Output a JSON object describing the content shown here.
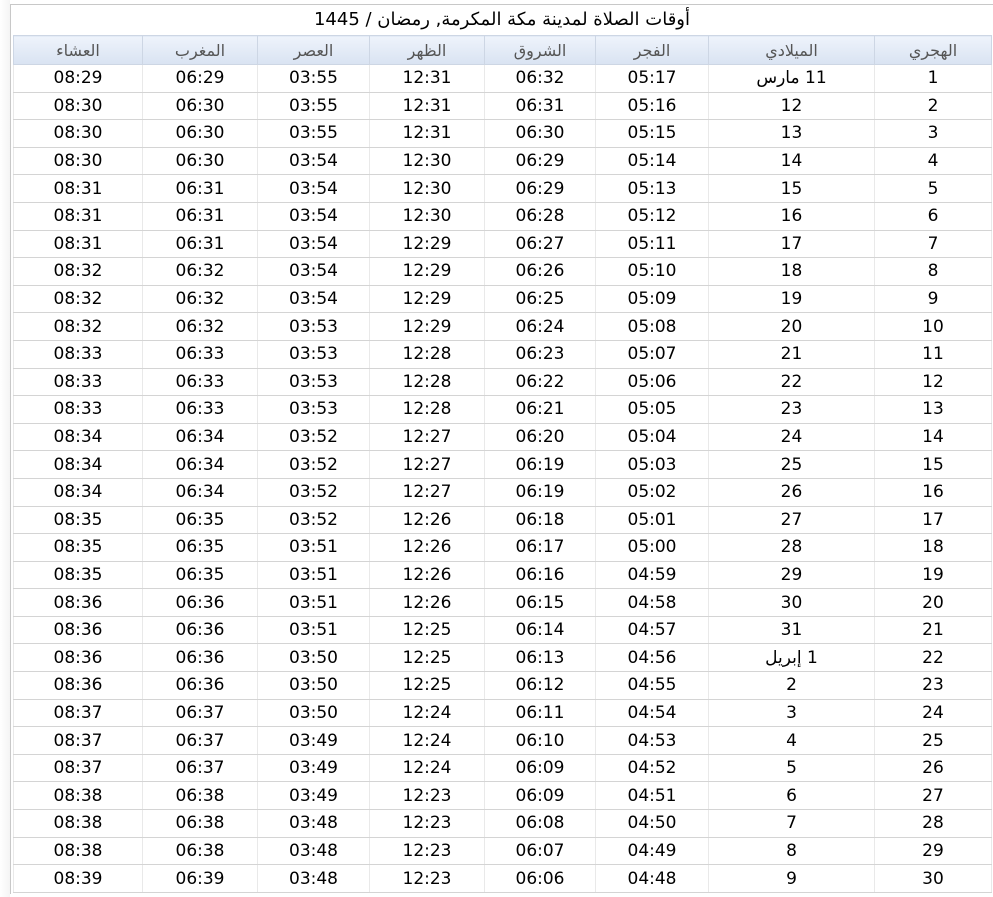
{
  "title": "أوقات الصلاة لمدينة مكة المكرمة, رمضان / 1445",
  "headers": [
    "الهجري",
    "الميلادي",
    "الفجر",
    "الشروق",
    "الظهر",
    "العصر",
    "المغرب",
    "العشاء"
  ],
  "rows": [
    [
      "1",
      "11 مارس",
      "05:17",
      "06:32",
      "12:31",
      "03:55",
      "06:29",
      "08:29"
    ],
    [
      "2",
      "12",
      "05:16",
      "06:31",
      "12:31",
      "03:55",
      "06:30",
      "08:30"
    ],
    [
      "3",
      "13",
      "05:15",
      "06:30",
      "12:31",
      "03:55",
      "06:30",
      "08:30"
    ],
    [
      "4",
      "14",
      "05:14",
      "06:29",
      "12:30",
      "03:54",
      "06:30",
      "08:30"
    ],
    [
      "5",
      "15",
      "05:13",
      "06:29",
      "12:30",
      "03:54",
      "06:31",
      "08:31"
    ],
    [
      "6",
      "16",
      "05:12",
      "06:28",
      "12:30",
      "03:54",
      "06:31",
      "08:31"
    ],
    [
      "7",
      "17",
      "05:11",
      "06:27",
      "12:29",
      "03:54",
      "06:31",
      "08:31"
    ],
    [
      "8",
      "18",
      "05:10",
      "06:26",
      "12:29",
      "03:54",
      "06:32",
      "08:32"
    ],
    [
      "9",
      "19",
      "05:09",
      "06:25",
      "12:29",
      "03:54",
      "06:32",
      "08:32"
    ],
    [
      "10",
      "20",
      "05:08",
      "06:24",
      "12:29",
      "03:53",
      "06:32",
      "08:32"
    ],
    [
      "11",
      "21",
      "05:07",
      "06:23",
      "12:28",
      "03:53",
      "06:33",
      "08:33"
    ],
    [
      "12",
      "22",
      "05:06",
      "06:22",
      "12:28",
      "03:53",
      "06:33",
      "08:33"
    ],
    [
      "13",
      "23",
      "05:05",
      "06:21",
      "12:28",
      "03:53",
      "06:33",
      "08:33"
    ],
    [
      "14",
      "24",
      "05:04",
      "06:20",
      "12:27",
      "03:52",
      "06:34",
      "08:34"
    ],
    [
      "15",
      "25",
      "05:03",
      "06:19",
      "12:27",
      "03:52",
      "06:34",
      "08:34"
    ],
    [
      "16",
      "26",
      "05:02",
      "06:19",
      "12:27",
      "03:52",
      "06:34",
      "08:34"
    ],
    [
      "17",
      "27",
      "05:01",
      "06:18",
      "12:26",
      "03:52",
      "06:35",
      "08:35"
    ],
    [
      "18",
      "28",
      "05:00",
      "06:17",
      "12:26",
      "03:51",
      "06:35",
      "08:35"
    ],
    [
      "19",
      "29",
      "04:59",
      "06:16",
      "12:26",
      "03:51",
      "06:35",
      "08:35"
    ],
    [
      "20",
      "30",
      "04:58",
      "06:15",
      "12:26",
      "03:51",
      "06:36",
      "08:36"
    ],
    [
      "21",
      "31",
      "04:57",
      "06:14",
      "12:25",
      "03:51",
      "06:36",
      "08:36"
    ],
    [
      "22",
      "1 إبريل",
      "04:56",
      "06:13",
      "12:25",
      "03:50",
      "06:36",
      "08:36"
    ],
    [
      "23",
      "2",
      "04:55",
      "06:12",
      "12:25",
      "03:50",
      "06:36",
      "08:36"
    ],
    [
      "24",
      "3",
      "04:54",
      "06:11",
      "12:24",
      "03:50",
      "06:37",
      "08:37"
    ],
    [
      "25",
      "4",
      "04:53",
      "06:10",
      "12:24",
      "03:49",
      "06:37",
      "08:37"
    ],
    [
      "26",
      "5",
      "04:52",
      "06:09",
      "12:24",
      "03:49",
      "06:37",
      "08:37"
    ],
    [
      "27",
      "6",
      "04:51",
      "06:09",
      "12:23",
      "03:49",
      "06:38",
      "08:38"
    ],
    [
      "28",
      "7",
      "04:50",
      "06:08",
      "12:23",
      "03:48",
      "06:38",
      "08:38"
    ],
    [
      "29",
      "8",
      "04:49",
      "06:07",
      "12:23",
      "03:48",
      "06:38",
      "08:38"
    ],
    [
      "30",
      "9",
      "04:48",
      "06:06",
      "12:23",
      "03:48",
      "06:39",
      "08:39"
    ]
  ]
}
